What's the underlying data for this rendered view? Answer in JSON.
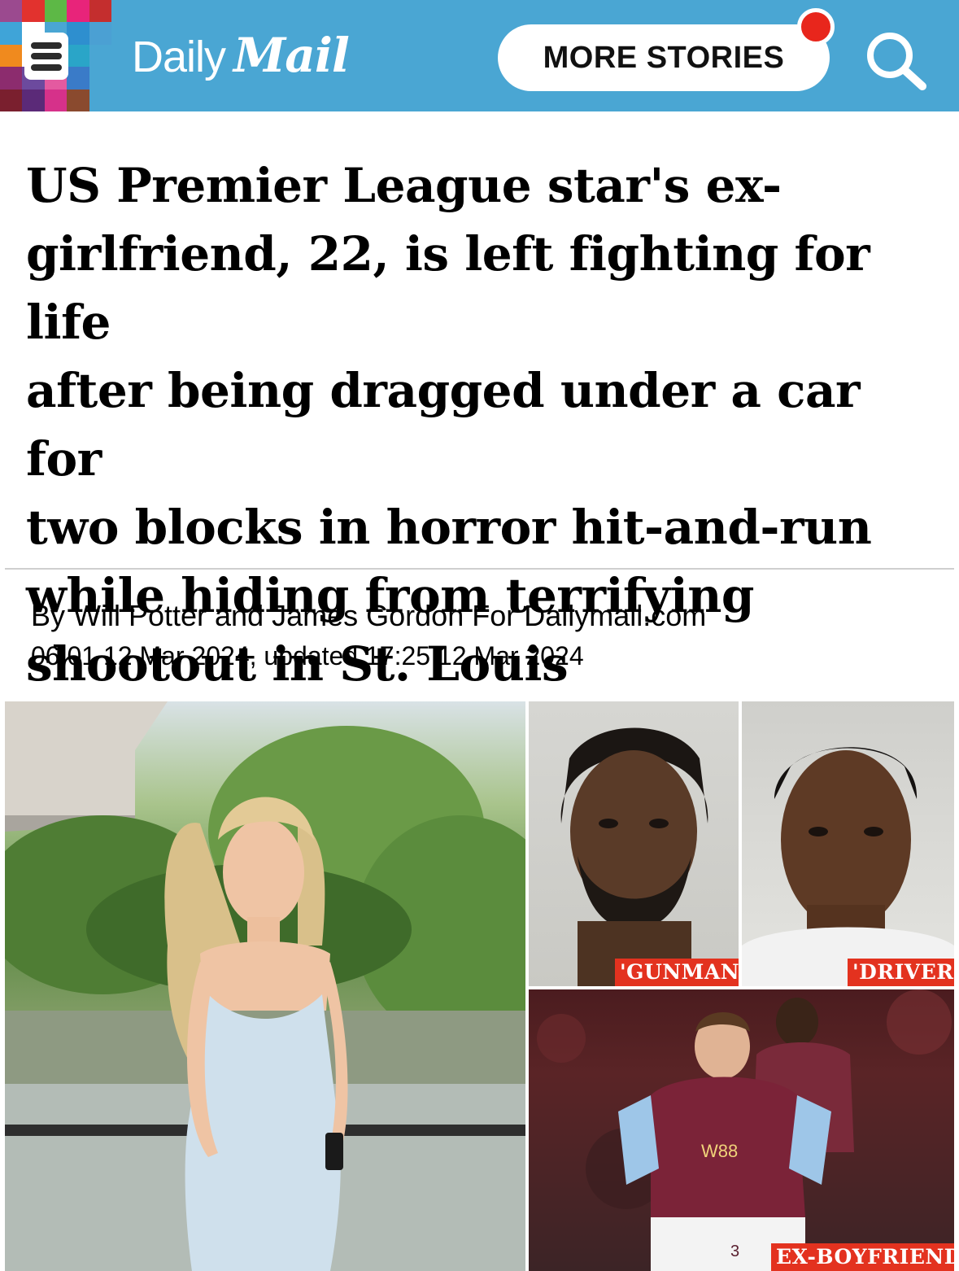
{
  "header": {
    "logo_daily": "Daily",
    "logo_mail": "Mail",
    "more_stories_label": "MORE STORIES",
    "brand_color": "#4aa6d3",
    "notification_dot_color": "#e8261c",
    "mosaic_colors": [
      "#9b4a8f",
      "#e2322e",
      "#5db846",
      "#e8247a",
      "#c42e2e",
      "#3fa4d8",
      "#ffffff",
      "#4aa6d3",
      "#2e8fcf",
      "#4ba0d3",
      "#f08a1e",
      "#ffffff",
      "#4b2c82",
      "#2aa5c8",
      "#4aa6d3",
      "#8c2c6e",
      "#6c4a9e",
      "#e45aa0",
      "#3a7bc8",
      "#4aa6d3",
      "#7a1f2e",
      "#5b2a78",
      "#d6318a",
      "#8a4a2e",
      "#4aa6d3"
    ],
    "icons": [
      "hamburger-menu-icon",
      "search-icon"
    ]
  },
  "article": {
    "headline_lines": [
      "US Premier League star's ex-",
      "girlfriend, 22, is left fighting for life",
      "after being dragged under a car for",
      "two blocks in horror hit-and-run",
      "while hiding from terrifying",
      "shootout in St. Louis"
    ],
    "byline": "By Will Potter and James Gordon For Dailymail.com",
    "dateline": "06:01 12 Mar 2024, updated 17:25 12 Mar 2024"
  },
  "images": {
    "gunman_tag": "'GUNMAN'",
    "driver_tag": "'DRIVER'",
    "ex_tag": "EX-BOYFRIEND",
    "shirt_sponsor": "W88",
    "shirt_number": "3",
    "tag_color": "#e3321f"
  }
}
